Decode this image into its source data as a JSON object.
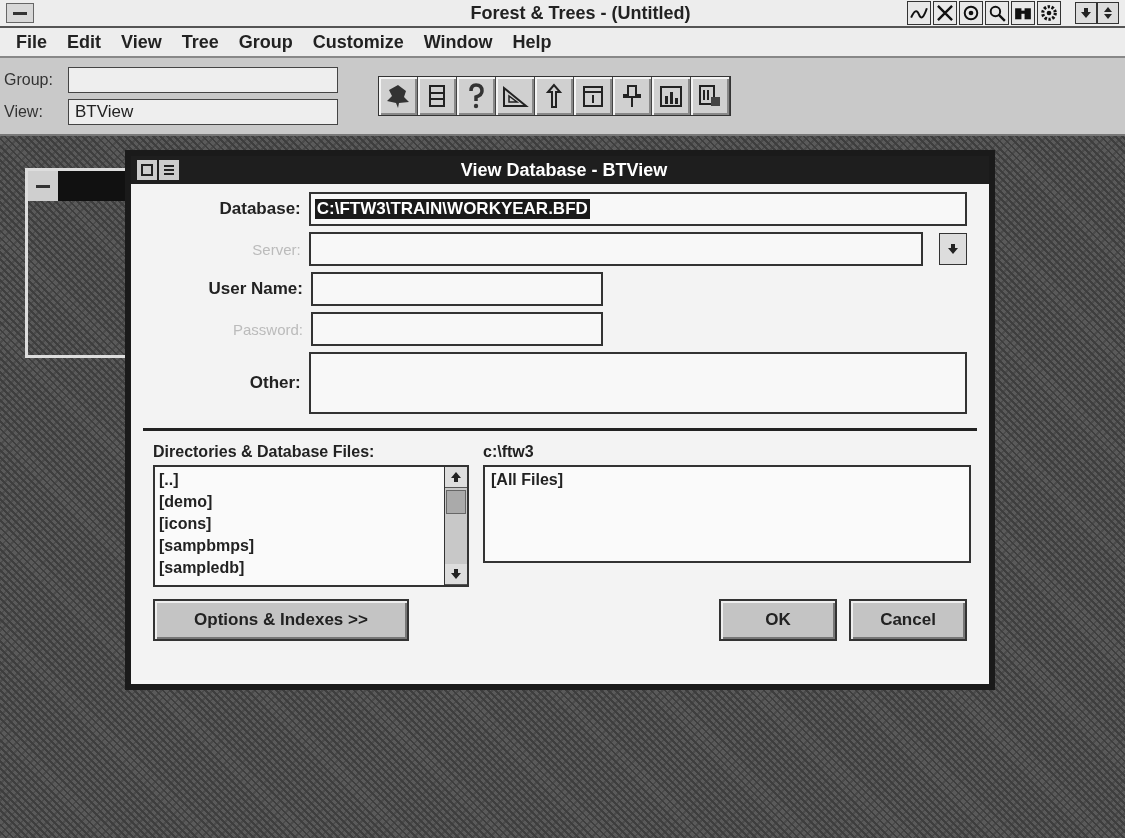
{
  "app": {
    "title": "Forest & Trees - (Untitled)"
  },
  "menu": [
    "File",
    "Edit",
    "View",
    "Tree",
    "Group",
    "Customize",
    "Window",
    "Help"
  ],
  "toolbar": {
    "group": {
      "label": "Group:"
    },
    "view": {
      "label": "View:",
      "value": "BTView"
    }
  },
  "dialog": {
    "title": "View Database - BTView",
    "fields": [
      {
        "kind": "text",
        "label": "Database:",
        "value": "C:\\FTW3\\TRAIN\\WORKYEAR.BFD",
        "highlighted": true,
        "disabled": false
      },
      {
        "kind": "combo",
        "label": "Server:",
        "disabled": true
      },
      {
        "kind": "short",
        "label": "User Name:",
        "disabled": false
      },
      {
        "kind": "short",
        "label": "Password:",
        "disabled": true
      },
      {
        "kind": "multiline",
        "label": "Other:",
        "disabled": false
      }
    ],
    "directories_label": "Directories & Database Files:",
    "directories": [
      "[..]",
      "[demo]",
      "[icons]",
      "[sampbmps]",
      "[sampledb]"
    ],
    "path": "c:\\ftw3",
    "files": [
      "[All Files]"
    ],
    "buttons": [
      {
        "kind": "options",
        "label": "Options & Indexes >>"
      },
      {
        "kind": "ok",
        "label": "OK"
      },
      {
        "kind": "cancel",
        "label": "Cancel"
      }
    ]
  }
}
